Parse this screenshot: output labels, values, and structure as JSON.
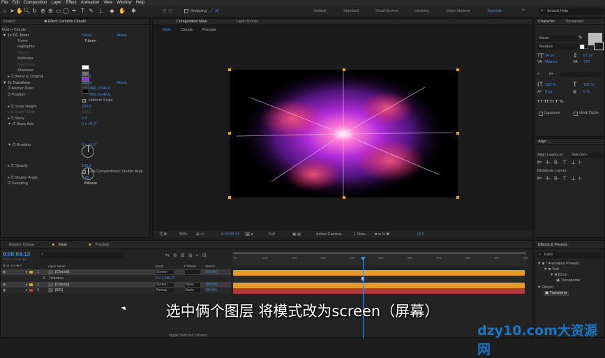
{
  "menu": [
    "File",
    "Edit",
    "Composition",
    "Layer",
    "Effect",
    "Animation",
    "View",
    "Window",
    "Help"
  ],
  "toolbar": {
    "snapping": "Snapping",
    "workspaces": [
      "Default",
      "Standard",
      "Small Screen",
      "Libraries",
      "Dope Motions",
      "Tutorials"
    ],
    "active_workspace": "Tutorials",
    "search": "Search Help"
  },
  "project_panel": {
    "tab_project": "Project",
    "tab_effects": "Effect Controls Clouds",
    "title": "Main • Clouds",
    "cc_toner": {
      "name": "CC Toner",
      "reset": "Reset",
      "about": "About...",
      "tones_label": "Tones",
      "tones_value": "Tritone",
      "highlights": "Highlights",
      "brights": "Brights",
      "midtones": "Midtones",
      "darktones": "Darktones",
      "shadows": "Shadows",
      "blend_label": "Blend w. Original",
      "blend_value": "0.0 %"
    },
    "transform": {
      "name": "Transform",
      "reset": "Reset",
      "about": "About...",
      "anchor_label": "Anchor Point",
      "anchor_value": "960.0,540.0",
      "position_label": "Position",
      "position_value": "960.0,540.0",
      "uniform": "Uniform Scale",
      "scale_h_label": "Scale Height",
      "scale_h_value": "200.0",
      "scale_w_label": "Scale Width",
      "scale_w_value": "100.0",
      "skew_label": "Skew",
      "skew_value": "0.0",
      "skew_axis_label": "Skew Axis",
      "skew_axis_value": "0 x +0.0°",
      "rotation_label": "Rotation",
      "rotation_value": "0 x +0.0°",
      "opacity_label": "Opacity",
      "opacity_value": "100.0",
      "comp_shutter": "Use Composition's Shutter Angl",
      "shutter_label": "Shutter Angle",
      "shutter_value": "0.00",
      "sampling_label": "Sampling",
      "sampling_value": "Bilinear"
    }
  },
  "comp_panel": {
    "tab": "Composition Main",
    "layer_tab": "Layer (none)",
    "crumbs": [
      "Main",
      "Clouds",
      "Fractals"
    ],
    "zoom": "50%",
    "time": "0:00:04:13",
    "resolution": "Full",
    "camera": "Active Camera",
    "view": "1 View",
    "exposure": "+0.0"
  },
  "character_panel": {
    "tab": "Character",
    "tab2": "Paragraph",
    "font": "Bison",
    "style": "Medium",
    "size": "34 px",
    "leading": "67 px",
    "kern": "Metrics",
    "track": "720",
    "stroke_unit": "px",
    "vscale": "100 %",
    "hscale": "100 %",
    "baseline": "0 px",
    "tsume": "0 %",
    "ligatures": "Ligatures",
    "hindi": "Hindi Digits"
  },
  "align_panel": {
    "tab": "Align",
    "align_to_label": "Align Layers to:",
    "align_to_value": "Selection",
    "distribute": "Distribute Layers:"
  },
  "effects_panel": {
    "tab": "Effects & Presets",
    "search": "trans",
    "tree": [
      "* Animation Presets",
      "Text",
      "Blurs",
      "Transporter",
      "Distort",
      "Transform"
    ]
  },
  "timeline": {
    "tabs": [
      "Render Queue",
      "Main",
      "Fractals"
    ],
    "time": "0:00:04:13",
    "frames": "00113 (24.00 fps)",
    "col_layer": "Layer Name",
    "col_mode": "Mode",
    "col_trk": "T TrkMat",
    "col_stretch": "Stretch",
    "layers": [
      {
        "num": "1",
        "name": "[Clouds]",
        "mode": "Screen",
        "trk": "",
        "stretch": "100.0%"
      },
      {
        "num": "2",
        "name": "[Clouds]",
        "mode": "Screen",
        "trk": "None",
        "stretch": "100.0%"
      },
      {
        "num": "3",
        "name": "[BG]",
        "mode": "Norma",
        "trk": "None",
        "stretch": "100.0%"
      }
    ],
    "rotation_label": "Rotation",
    "rotation_value": "0 x +180.0°",
    "ruler": [
      "0s",
      "01s",
      "02s",
      "03s",
      "04s",
      "05s",
      "06s",
      "07s",
      "08s",
      "09s",
      "10s"
    ],
    "footer": "Toggle Switches / Modes"
  },
  "subtitle": "选中俩个图层 将模式改为screen（屏幕）",
  "watermark": "dzy10.com大资源网",
  "colors": {
    "accent": "#3e8ee8",
    "bar": "#e7a33a",
    "panel": "#232323",
    "highlight_swatch": "#ffffff",
    "midtone_swatch": "#8b2bd9",
    "shadow_swatch": "#000000"
  }
}
